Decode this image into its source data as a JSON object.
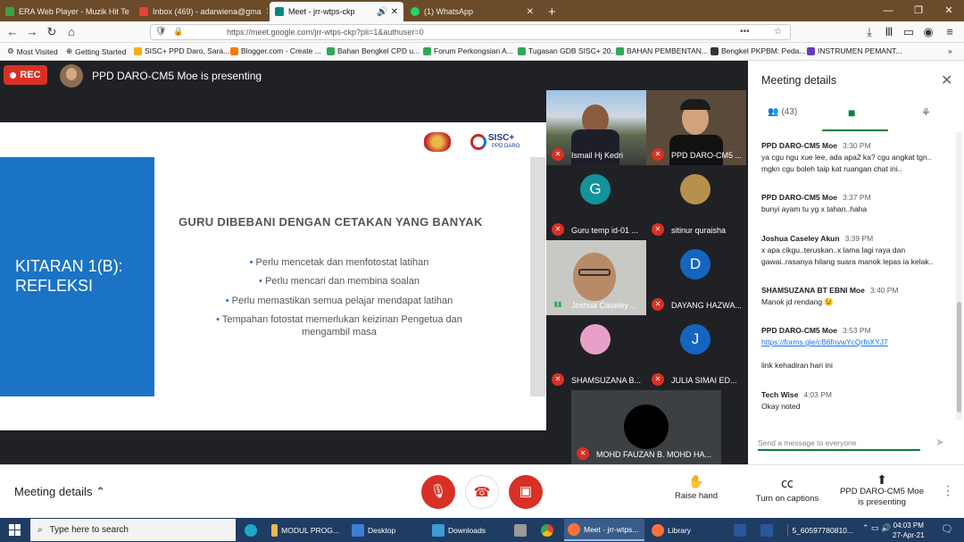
{
  "browser": {
    "tabs": [
      {
        "title": "ERA Web Player - Muzik Hit Te",
        "color": "#3aa345",
        "active": false
      },
      {
        "title": "Inbox (469) - adarwiena@gma",
        "color": "#ea4335",
        "active": false
      },
      {
        "title": "Meet - jrr-wtps-ckp",
        "color": "#00897b",
        "active": true
      },
      {
        "title": "(1) WhatsApp",
        "color": "#25d366",
        "active": false
      }
    ],
    "new_tab": "+",
    "url": "https://meet.google.com/jrr-wtps-ckp?pli=1&authuser=0",
    "bookmarks": [
      "Most Visited",
      "Getting Started",
      "SISC+ PPD Daro, Sara...",
      "Blogger.com - Create ...",
      "Bahan Bengkel CPD u...",
      "Forum Perkongsian A...",
      "Tugasan GDB SISC+ 20...",
      "BAHAN PEMBENTAN...",
      "Bengkel PKPBM: Peda...",
      "INSTRUMEN PEMANT..."
    ]
  },
  "meet": {
    "rec_label": "REC",
    "presenting_text": "PPD DARO-CM5 Moe is presenting",
    "slide": {
      "title": "KITARAN 1(B):\nREFLEKSI",
      "heading": "GURU DIBEBANI DENGAN CETAKAN YANG BANYAK",
      "logo_text": "SISC+",
      "logo_sub": "PPD DARO",
      "bullets": [
        "Perlu mencetak dan menfotostat latihan",
        "Perlu mencari dan membina soalan",
        "Perlu memastikan semua pelajar mendapat latihan",
        "Tempahan fotostat memerlukan keizinan Pengetua dan mengambil masa"
      ]
    },
    "participants": [
      {
        "name": "Ismail Hj Kedri",
        "initial": "",
        "color": ""
      },
      {
        "name": "PPD DARO-CM5 ...",
        "initial": "",
        "color": ""
      },
      {
        "name": "Guru temp id-01 ...",
        "initial": "G",
        "color": "#12939a"
      },
      {
        "name": "sitinur quraisha",
        "initial": "",
        "color": ""
      },
      {
        "name": "Joshua Caseley ...",
        "initial": "",
        "color": ""
      },
      {
        "name": "DAYANG HAZWA...",
        "initial": "D",
        "color": "#1565c0"
      },
      {
        "name": "SHAMSUZANA B...",
        "initial": "",
        "color": ""
      },
      {
        "name": "JULIA SIMAI ED...",
        "initial": "J",
        "color": "#1565c0"
      },
      {
        "name": "MOHD FAUZAN B. MOHD HA...",
        "initial": "",
        "color": ""
      }
    ]
  },
  "bottom": {
    "meeting_details": "Meeting details",
    "raise_hand": "Raise hand",
    "captions": "Turn on captions",
    "presenting": "PPD DARO-CM5 Moe is presenting"
  },
  "panel": {
    "title": "Meeting details",
    "people_count": "(43)",
    "messages": [
      {
        "sender": "PPD DARO-CM5 Moe",
        "time": "3:30 PM",
        "lines": [
          "ya cgu ngu xue lee, ada apa2 ka? cgu angkat tgn..",
          "mgkn cgu boleh taip kat ruangan chat ini.."
        ]
      },
      {
        "sender": "PPD DARO-CM5 Moe",
        "time": "3:37 PM",
        "lines": [
          "bunyi ayam tu yg x tahan..haha"
        ]
      },
      {
        "sender": "Joshua Caseley Akun",
        "time": "3:39 PM",
        "lines": [
          "x apa cikgu..teruskan..x lama lagi raya dan",
          "gawai..rasanya hilang suara manok lepas ia kelak.."
        ]
      },
      {
        "sender": "SHAMSUZANA BT EBNI Moe",
        "time": "3:40 PM",
        "lines": [
          "Manok jd rendang 😉"
        ]
      },
      {
        "sender": "PPD DARO-CM5 Moe",
        "time": "3:53 PM",
        "link": "https://forms.gle/cB6fnvwYcQrfnXYJ7",
        "lines": [
          "link kehadiran hari ini"
        ]
      },
      {
        "sender": "Tech Wise",
        "time": "4:03 PM",
        "lines": [
          "Okay noted"
        ]
      }
    ],
    "input_placeholder": "Send a message to everyone"
  },
  "taskbar": {
    "search": "Type here to search",
    "items": [
      "MODUL PROG...",
      "Desktop",
      "Downloads",
      "Meet - jrr-wtps...",
      "Library",
      "5_60597780810..."
    ],
    "time": "04:03 PM",
    "date": "27-Apr-21"
  },
  "colors": {
    "accent": "#0b8043",
    "rec": "#d93025",
    "slide_blue": "#1a73c4"
  }
}
